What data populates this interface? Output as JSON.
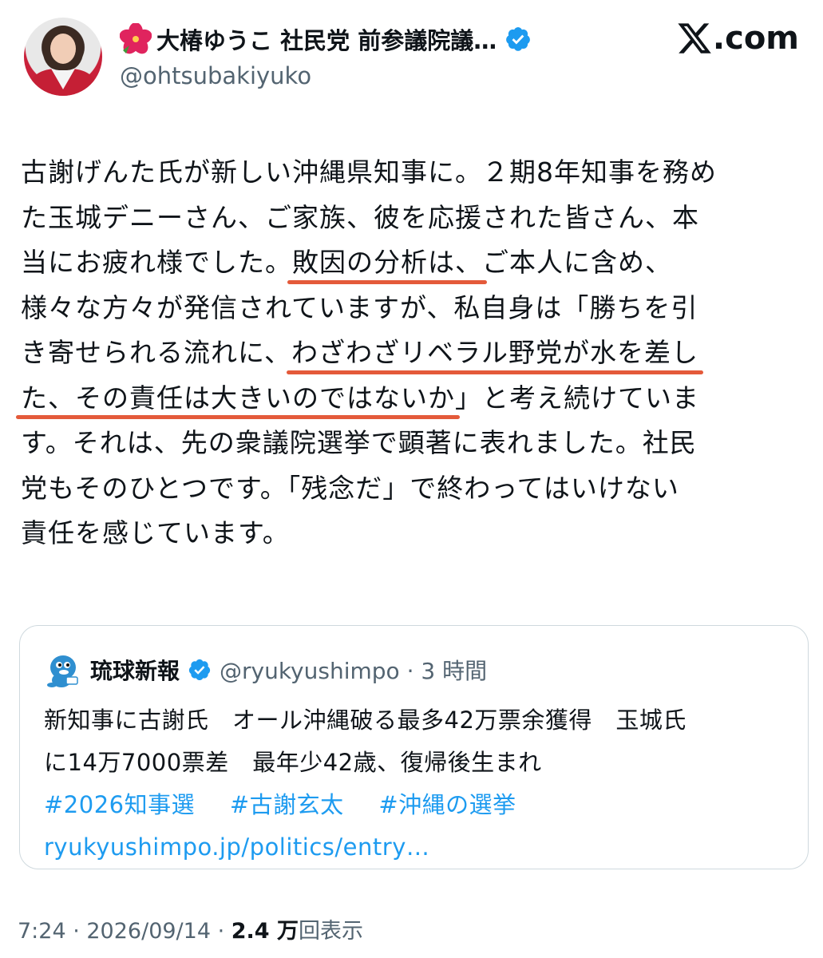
{
  "author": {
    "display_name": "大椿ゆうこ 社民党 前参議院議…",
    "handle": "@ohtsubakiyuko",
    "flower_icon": "hibiscus-emoji",
    "verified_icon": "verified-badge-icon"
  },
  "brand": {
    "logo_text": ".com",
    "logo_icon": "x-logo-icon"
  },
  "post": {
    "lines": [
      {
        "before": "古謝げんた氏が新しい沖縄県知事に。２期8年知事を務め",
        "under": "",
        "after": ""
      },
      {
        "before": "た玉城デニーさん、ご家族、彼を応援された皆さん、本",
        "under": "",
        "after": ""
      },
      {
        "before": "当にお疲れ様でした。",
        "under": "敗因の分析は、",
        "after": "ご本人に含め、"
      },
      {
        "before": "様々な方々が発信されていますが、私自身は「勝ちを引",
        "under": "",
        "after": ""
      },
      {
        "before": "き寄せられる流れに、",
        "under": "わざわざリベラル野党が水を差し",
        "after": ""
      },
      {
        "before": "",
        "under": "た、その責任は大きいのではないか",
        "after": "」と考え続けていま"
      },
      {
        "before": "す。それは、先の衆議院選挙で顕著に表れました。社民",
        "under": "",
        "after": ""
      },
      {
        "before": "党もそのひとつです。「残念だ」で終わってはいけない",
        "under": "",
        "after": ""
      },
      {
        "before": "責任を感じています。",
        "under": "",
        "after": ""
      }
    ],
    "highlight_color": "#e45a3a"
  },
  "quoted": {
    "name": "琉球新報",
    "handle_time": "@ryukyushimpo · 3 時間",
    "avatar_icon": "ryukyushimpo-mascot-icon",
    "text_line1": "新知事に古謝氏　オール沖縄破る最多42万票余獲得　玉城氏",
    "text_line2": "に14万7000票差　最年少42歳、復帰後生まれ",
    "hashtags": [
      "#2026知事選",
      "#古謝玄太",
      "#沖縄の選挙"
    ],
    "link": "ryukyushimpo.jp/politics/entry…"
  },
  "meta": {
    "time": "7:24 · 2026/09/14 · ",
    "views_count": "2.4 万",
    "views_label": "回表示"
  },
  "colors": {
    "link": "#1d9bf0",
    "muted": "#536471",
    "verified": "#1d9bf0"
  }
}
